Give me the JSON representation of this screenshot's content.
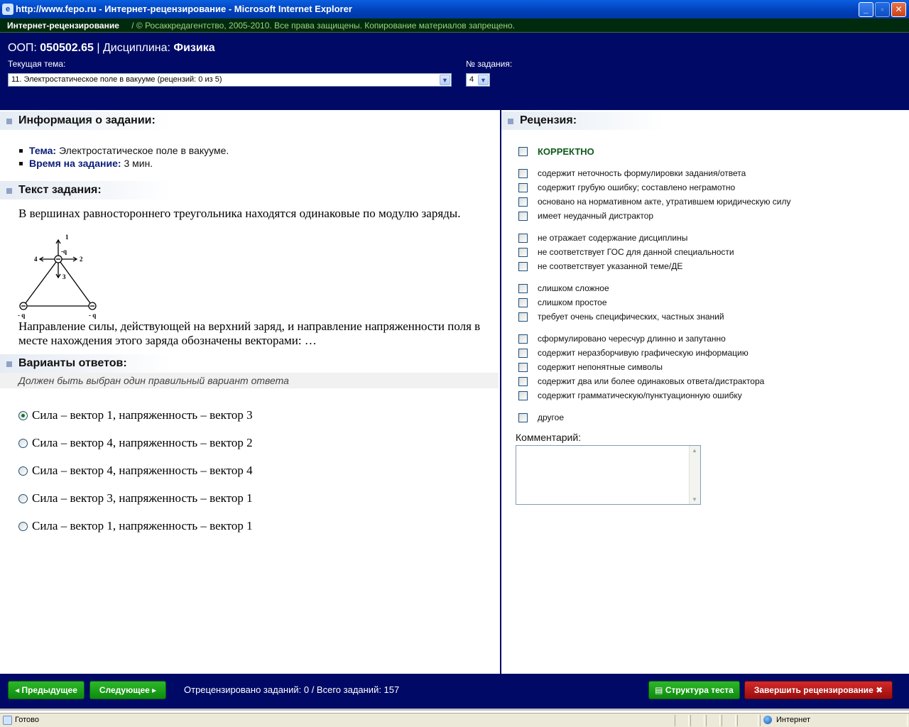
{
  "window": {
    "title": "http://www.fepo.ru - Интернет-рецензирование - Microsoft Internet Explorer",
    "minimize": "_",
    "maximize": "▫",
    "close": "✕"
  },
  "strip": {
    "app_name": "Интернет-рецензирование",
    "copyright": "/  © Росаккредагентство, 2005-2010. Все права защищены. Копирование материалов запрещено."
  },
  "header": {
    "oop_label": "ООП: ",
    "oop_value": "050502.65",
    "separator": " | Дисциплина: ",
    "discipline": "Физика",
    "topic_label": "Текущая тема:",
    "topic_value": "11. Электростатическое поле в вакууме  (рецензий: 0 из 5)",
    "task_no_label": "№ задания:",
    "task_no_value": "4"
  },
  "task_info": {
    "heading": "Информация о задании:",
    "topic_key": "Тема:",
    "topic_val": " Электростатическое поле в вакууме.",
    "time_key": "Время на задание:",
    "time_val": " 3 мин."
  },
  "task_text": {
    "heading": "Текст задания:",
    "para1": "В вершинах равностороннего треугольника находятся одинаковые по модулю заряды.",
    "para2": "Направление силы, действующей на верхний заряд, и направление напряженности поля в месте нахождения этого заряда обозначены векторами: …",
    "figure": {
      "label_1": "1",
      "label_2": "2",
      "label_3": "3",
      "label_4": "4",
      "label_q_top": "-q",
      "label_q_left": "- q",
      "label_q_right": "- q"
    }
  },
  "answers": {
    "heading": "Варианты ответов:",
    "hint": "Должен быть выбран один правильный вариант ответа",
    "options": [
      {
        "label": "Сила – вектор 1, напряженность – вектор 3",
        "selected": true
      },
      {
        "label": "Сила – вектор 4, напряженность – вектор 2",
        "selected": false
      },
      {
        "label": "Сила – вектор 4, напряженность – вектор 4",
        "selected": false
      },
      {
        "label": "Сила – вектор 3, напряженность – вектор 1",
        "selected": false
      },
      {
        "label": "Сила – вектор 1, напряженность – вектор 1",
        "selected": false
      }
    ]
  },
  "review": {
    "heading": "Рецензия:",
    "correct": "КОРРЕКТНО",
    "items": [
      "содержит неточность формулировки задания/ответа",
      "содержит грубую ошибку; составлено неграмотно",
      "основано на нормативном акте, утратившем юридическую силу",
      "имеет неудачный дистрактор",
      "не отражает содержание дисциплины",
      "не соответствует ГОС для данной специальности",
      "не соответствует указанной теме/ДЕ",
      "слишком сложное",
      "слишком простое",
      "требует очень специфических, частных знаний",
      "сформулировано чересчур длинно и запутанно",
      "содержит неразборчивую графическую информацию",
      "содержит непонятные символы",
      "содержит два или более одинаковых ответа/дистрактора",
      "содержит грамматическую/пунктуационную ошибку",
      "другое"
    ],
    "comment_label": "Комментарий:",
    "comment_value": ""
  },
  "footer": {
    "prev": "◂ Предыдущее",
    "next": "Следующее ▸",
    "progress": "Отрецензировано заданий: 0 / Всего заданий:  157",
    "structure": "▤ Структура теста",
    "finish": "Завершить рецензирование ✖"
  },
  "status": {
    "left": "Готово",
    "zone": "Интернет"
  }
}
